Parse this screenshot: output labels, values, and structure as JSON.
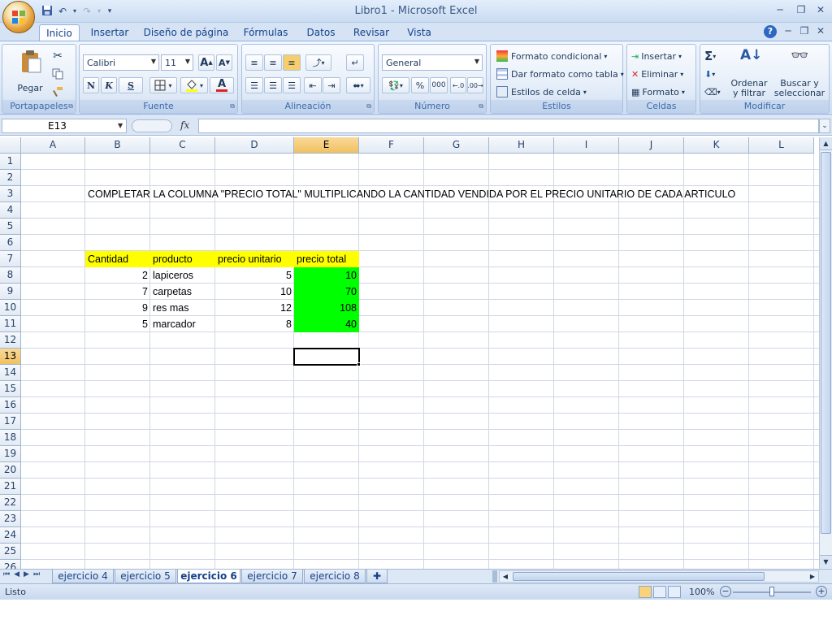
{
  "window": {
    "title": "Libro1 - Microsoft Excel",
    "minimize_glyph": "─",
    "restore_glyph": "❐",
    "close_glyph": "✕"
  },
  "quick_access": {
    "save_icon": "save-icon",
    "undo_icon": "undo-icon",
    "redo_icon": "redo-icon"
  },
  "tabs": [
    "Inicio",
    "Insertar",
    "Diseño de página",
    "Fórmulas",
    "Datos",
    "Revisar",
    "Vista"
  ],
  "active_tab": "Inicio",
  "ribbon": {
    "portapapeles": {
      "label": "Portapapeles",
      "paste": "Pegar"
    },
    "fuente": {
      "label": "Fuente",
      "font": "Calibri",
      "size": "11",
      "bold": "N",
      "italic": "K",
      "underline": "S"
    },
    "alineacion": {
      "label": "Alineación"
    },
    "numero": {
      "label": "Número",
      "format": "General",
      "percent": "%",
      "thousands": "000"
    },
    "estilos": {
      "label": "Estilos",
      "conditional": "Formato condicional",
      "as_table": "Dar formato como tabla",
      "cell_styles": "Estilos de celda"
    },
    "celdas": {
      "label": "Celdas",
      "insert": "Insertar",
      "delete": "Eliminar",
      "format": "Formato"
    },
    "modificar": {
      "label": "Modificar",
      "sort_1": "Ordenar",
      "sort_2": "y filtrar",
      "find_1": "Buscar y",
      "find_2": "seleccionar"
    }
  },
  "formula_bar": {
    "name_box": "E13",
    "fx": "fx",
    "formula": ""
  },
  "columns": [
    "A",
    "B",
    "C",
    "D",
    "E",
    "F",
    "G",
    "H",
    "I",
    "J",
    "K",
    "L"
  ],
  "rows": [
    "1",
    "2",
    "3",
    "4",
    "5",
    "6",
    "7",
    "8",
    "9",
    "10",
    "11",
    "12",
    "13",
    "14",
    "15",
    "16",
    "17",
    "18",
    "19",
    "20",
    "21",
    "22",
    "23",
    "24",
    "25",
    "26"
  ],
  "selected_cell": {
    "column": "E",
    "row": "13"
  },
  "sheet": {
    "instruction": "COMPLETAR LA COLUMNA \"PRECIO TOTAL\" MULTIPLICANDO LA CANTIDAD VENDIDA POR EL PRECIO UNITARIO DE CADA ARTICULO",
    "headers": {
      "cantidad": "Cantidad",
      "producto": "producto",
      "precio_unitario": "precio unitario",
      "precio_total": "precio total"
    },
    "items": [
      {
        "cantidad": "2",
        "producto": "lapiceros",
        "precio_unitario": "5",
        "precio_total": "10"
      },
      {
        "cantidad": "7",
        "producto": "carpetas",
        "precio_unitario": "10",
        "precio_total": "70"
      },
      {
        "cantidad": "9",
        "producto": "res mas",
        "precio_unitario": "12",
        "precio_total": "108"
      },
      {
        "cantidad": "5",
        "producto": "marcador",
        "precio_unitario": "8",
        "precio_total": "40"
      }
    ]
  },
  "colors": {
    "header_fill": "#ffff00",
    "total_fill": "#00ff00",
    "selection": "#f1c15f"
  },
  "sheet_tabs": [
    "ejercicio 4",
    "ejercicio 5",
    "ejercicio 6",
    "ejercicio 7",
    "ejercicio 8"
  ],
  "active_sheet": "ejercicio 6",
  "status": {
    "ready": "Listo",
    "zoom": "100%"
  }
}
